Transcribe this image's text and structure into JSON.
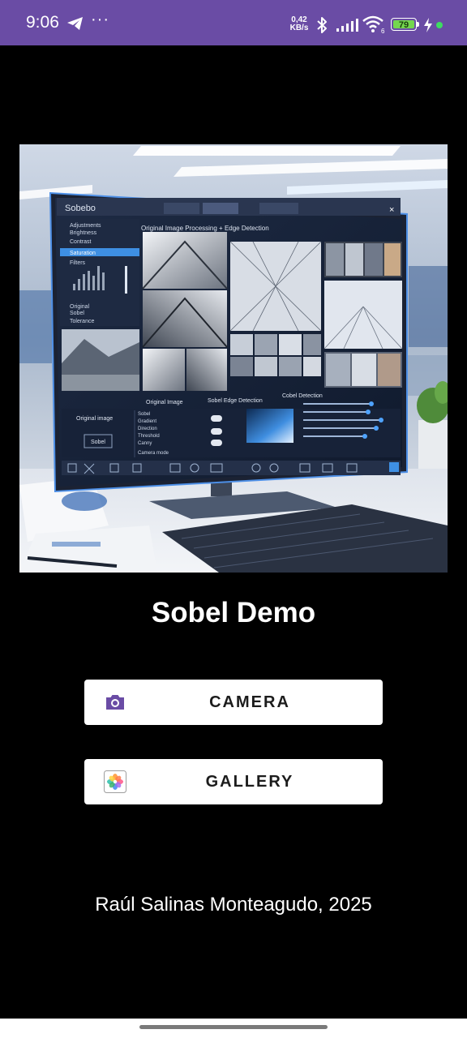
{
  "status_bar": {
    "time": "9:06",
    "net_speed_value": "0,42",
    "net_speed_unit": "KB/s",
    "battery_level": "79",
    "color": "#6a4ca5"
  },
  "hero_image": {
    "window_title": "Sobebo",
    "viewer_title": "Original Image Processing + Edge Detection",
    "caption_original": "Original Image",
    "caption_sobel": "Sobel Edge Detection",
    "caption_other": "Cobel Detection",
    "sidebar_items": [
      "Adjustments",
      "Brightness",
      "Contrast",
      "Saturation",
      "Filters",
      "Original",
      "Sobel",
      "Tolerance"
    ],
    "panel_title": "Original image",
    "panel_button": "Sobel",
    "panel_list": [
      "Sobel",
      "Gradient",
      "Direction",
      "Threshold",
      "Canny",
      "Camera mode"
    ]
  },
  "main": {
    "title": "Sobel Demo",
    "camera_button": {
      "label": "CAMERA",
      "icon": "camera-icon",
      "icon_color": "#6a4ca5"
    },
    "gallery_button": {
      "label": "GALLERY",
      "icon": "photos-icon"
    },
    "author": "Raúl Salinas Monteagudo, 2025"
  },
  "nav_bar": {
    "indicator": "home-indicator"
  }
}
